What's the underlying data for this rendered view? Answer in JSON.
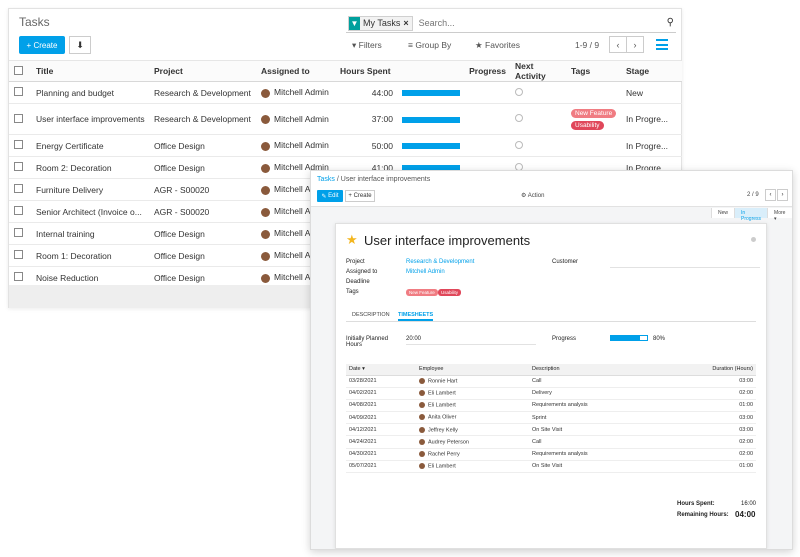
{
  "list": {
    "title": "Tasks",
    "facet_label": "My Tasks",
    "search_placeholder": "Search...",
    "create_label": "Create",
    "filters_label": "Filters",
    "groupby_label": "Group By",
    "favorites_label": "Favorites",
    "pager": "1-9 / 9",
    "columns": [
      "Title",
      "Project",
      "Assigned to",
      "Hours Spent",
      "Progress",
      "Next Activity",
      "Tags",
      "Stage"
    ],
    "rows": [
      {
        "title": "Planning and budget",
        "project": "Research & Development",
        "assigned": "Mitchell Admin",
        "hours": "44:00",
        "stage": "New",
        "tags": []
      },
      {
        "title": "User interface improvements",
        "project": "Research & Development",
        "assigned": "Mitchell Admin",
        "hours": "37:00",
        "stage": "In Progre...",
        "tags": [
          "New Feature",
          "Usability"
        ]
      },
      {
        "title": "Energy Certificate",
        "project": "Office Design",
        "assigned": "Mitchell Admin",
        "hours": "50:00",
        "stage": "In Progre...",
        "tags": []
      },
      {
        "title": "Room 2: Decoration",
        "project": "Office Design",
        "assigned": "Mitchell Admin",
        "hours": "41:00",
        "stage": "In Progre...",
        "tags": []
      },
      {
        "title": "Furniture Delivery",
        "project": "AGR - S00020",
        "assigned": "Mitchell A",
        "hours": "",
        "stage": "",
        "tags": []
      },
      {
        "title": "Senior Architect (Invoice o...",
        "project": "AGR - S00020",
        "assigned": "Mitchell A",
        "hours": "",
        "stage": "",
        "tags": []
      },
      {
        "title": "Internal training",
        "project": "Office Design",
        "assigned": "Mitchell A",
        "hours": "",
        "stage": "",
        "tags": []
      },
      {
        "title": "Room 1: Decoration",
        "project": "Office Design",
        "assigned": "Mitchell A",
        "hours": "",
        "stage": "",
        "tags": []
      },
      {
        "title": "Noise Reduction",
        "project": "Office Design",
        "assigned": "Mitchell A",
        "hours": "",
        "stage": "",
        "tags": []
      }
    ]
  },
  "form": {
    "breadcrumb_root": "Tasks",
    "breadcrumb_sep": "/",
    "breadcrumb_current": "User interface improvements",
    "edit_label": "Edit",
    "create_label": "Create",
    "action_label": "Action",
    "pager": "2 / 9",
    "stages": [
      "New",
      "In Progress",
      "More"
    ],
    "task_name": "User interface improvements",
    "labels": {
      "project": "Project",
      "assigned": "Assigned to",
      "deadline": "Deadline",
      "tags": "Tags",
      "customer": "Customer",
      "planned": "Initially Planned Hours",
      "progress": "Progress"
    },
    "project": "Research & Development",
    "assigned": "Mitchell Admin",
    "tags": [
      "New Feature",
      "Usability"
    ],
    "tabs": [
      "DESCRIPTION",
      "TIMESHEETS"
    ],
    "planned_hours": "20:00",
    "progress_pct": 80,
    "progress_text": "80%",
    "ts_columns": [
      "Date",
      "Employee",
      "Description",
      "Duration (Hours)"
    ],
    "timesheets": [
      {
        "date": "03/28/2021",
        "employee": "Ronnie Hart",
        "desc": "Call",
        "dur": "03:00"
      },
      {
        "date": "04/02/2021",
        "employee": "Eli Lambert",
        "desc": "Delivery",
        "dur": "02:00"
      },
      {
        "date": "04/08/2021",
        "employee": "Eli Lambert",
        "desc": "Requirements analysis",
        "dur": "01:00"
      },
      {
        "date": "04/09/2021",
        "employee": "Anita Oliver",
        "desc": "Sprint",
        "dur": "03:00"
      },
      {
        "date": "04/12/2021",
        "employee": "Jeffrey Kelly",
        "desc": "On Site Visit",
        "dur": "03:00"
      },
      {
        "date": "04/24/2021",
        "employee": "Audrey Peterson",
        "desc": "Call",
        "dur": "02:00"
      },
      {
        "date": "04/30/2021",
        "employee": "Rachel Perry",
        "desc": "Requirements analysis",
        "dur": "02:00"
      },
      {
        "date": "05/07/2021",
        "employee": "Eli Lambert",
        "desc": "On Site Visit",
        "dur": "01:00"
      }
    ],
    "hours_spent_label": "Hours Spent:",
    "hours_spent": "16:00",
    "remaining_label": "Remaining Hours:",
    "remaining": "04:00"
  },
  "colors": {
    "primary": "#00a0e9",
    "tag_new_feature": "#f07c82",
    "tag_usability": "#e0475a",
    "star": "#f3b61f"
  }
}
